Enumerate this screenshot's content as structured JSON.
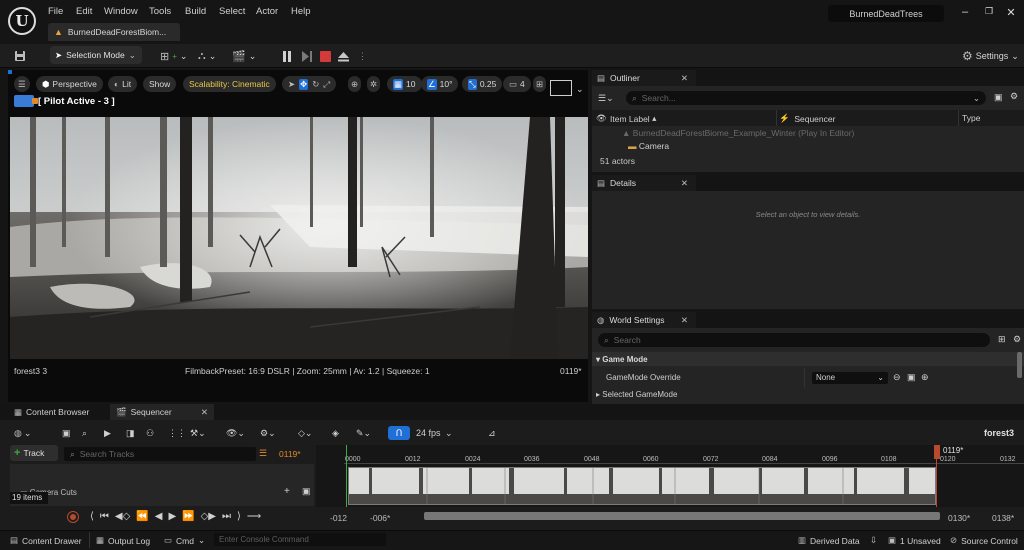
{
  "menu": [
    "File",
    "Edit",
    "Window",
    "Tools",
    "Build",
    "Select",
    "Actor",
    "Help"
  ],
  "project_tab": "BurnedDeadForestBiom...",
  "project_name": "BurnedDeadTrees",
  "toolbar": {
    "selection_mode": "Selection Mode",
    "settings": "Settings"
  },
  "viewport": {
    "perspective": "Perspective",
    "lit": "Lit",
    "show": "Show",
    "scalability": "Scalability: Cinematic",
    "grid_snap": "10",
    "rot_snap": "10°",
    "scale_snap": "0.25",
    "cam_speed": "4",
    "pilot": "[ Pilot Active - 3 ]",
    "actor_name": "forest3 3",
    "filmback": "FilmbackPreset: 16:9 DSLR | Zoom: 25mm | Av: 1.2 | Squeeze: 1",
    "frame": "0119*"
  },
  "outliner": {
    "title": "Outliner",
    "search_placeholder": "Search...",
    "col_label": "Item Label",
    "col_sequencer": "Sequencer",
    "col_type": "Type",
    "row_world": "BurnedDeadForestBiome_Example_Winter (Play In Editor)",
    "row_camera": "Camera",
    "count": "51 actors"
  },
  "details": {
    "title": "Details",
    "empty": "Select an object to view details."
  },
  "world_settings": {
    "title": "World Settings",
    "search_placeholder": "Search",
    "section": "Game Mode",
    "override_label": "GameMode Override",
    "override_value": "None",
    "selected": "Selected GameMode"
  },
  "bottom_tabs": {
    "content_browser": "Content Browser",
    "sequencer": "Sequencer"
  },
  "sequencer": {
    "fps": "24 fps",
    "name": "forest3",
    "add_track": "Track",
    "search_placeholder": "Search Tracks",
    "current_frame": "0119*",
    "track": "Camera Cuts",
    "items": "19 items",
    "playhead": "0119*",
    "ticks": [
      "0000",
      "0012",
      "0024",
      "0036",
      "0048",
      "0060",
      "0072",
      "0084",
      "0096",
      "0108",
      "0120",
      "0132"
    ],
    "start_in": "-012",
    "start_view": "-006*",
    "end_view": "0130*",
    "end_in": "0138*"
  },
  "status": {
    "content_drawer": "Content Drawer",
    "output_log": "Output Log",
    "cmd": "Cmd",
    "console_placeholder": "Enter Console Command",
    "derived_data": "Derived Data",
    "unsaved": "1 Unsaved",
    "source_control": "Source Control"
  },
  "colors": {
    "accent_blue": "#1f6fd6",
    "stop_red": "#d33a3a",
    "scalability_yellow": "#e8c84a",
    "playhead": "#b54a2f",
    "add_green": "#3faa3f"
  }
}
